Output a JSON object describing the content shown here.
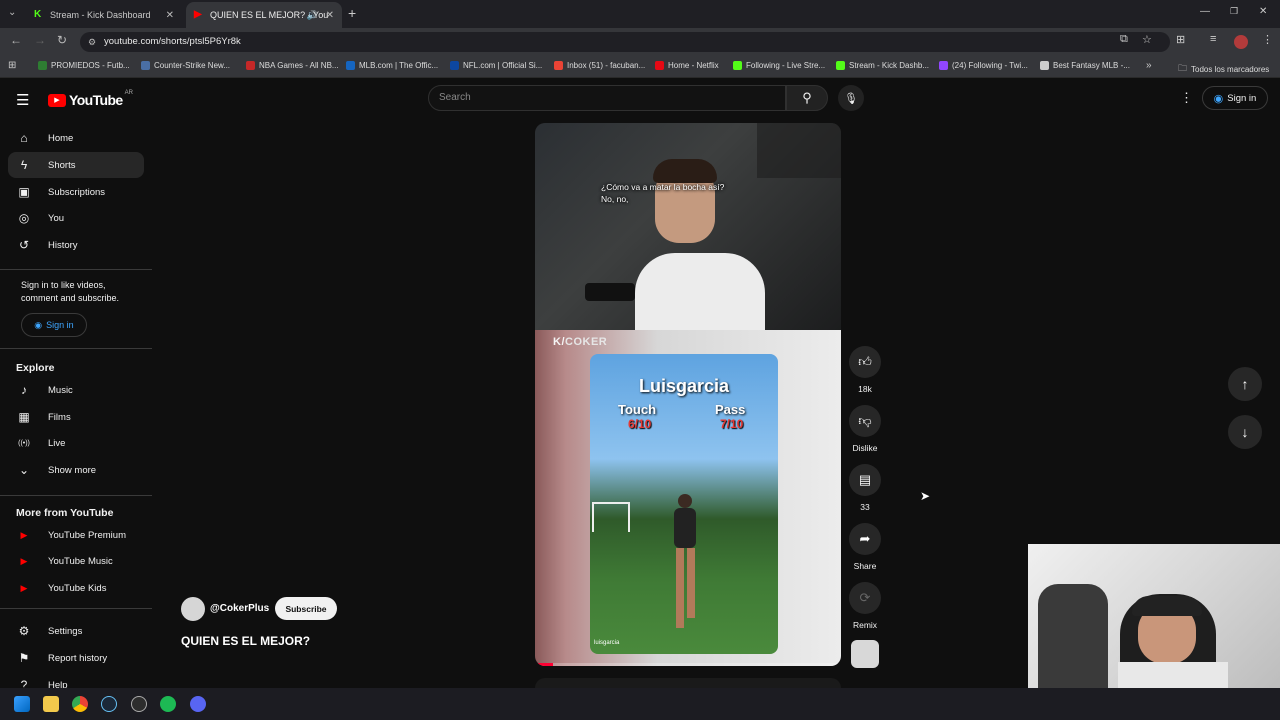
{
  "browser": {
    "tabs": [
      {
        "title": "Stream - Kick Dashboard",
        "active": false
      },
      {
        "title": "QUIEN ES EL MEJOR? - You",
        "active": true
      }
    ],
    "url": "youtube.com/shorts/ptsl5P6Yr8k",
    "bookmarks": [
      {
        "label": "PROMIEDOS - Futb...",
        "color": "#2e7d32"
      },
      {
        "label": "Counter-Strike New...",
        "color": "#4a6fa5"
      },
      {
        "label": "NBA Games - All NB...",
        "color": "#c62828"
      },
      {
        "label": "MLB.com | The Offic...",
        "color": "#1565c0"
      },
      {
        "label": "NFL.com | Official Si...",
        "color": "#0d47a1"
      },
      {
        "label": "Inbox (51) - facuban...",
        "color": "#ea4335"
      },
      {
        "label": "Home - Netflix",
        "color": "#e50914"
      },
      {
        "label": "Following - Live Stre...",
        "color": "#53fc18"
      },
      {
        "label": "Stream - Kick Dashb...",
        "color": "#53fc18"
      },
      {
        "label": "(24) Following - Twi...",
        "color": "#9146ff"
      },
      {
        "label": "Best Fantasy MLB -...",
        "color": "#cccccc"
      }
    ],
    "bookmarks_all": "Todos los marcadores"
  },
  "youtube": {
    "logo_text": "YouTube",
    "country": "AR",
    "search_placeholder": "Search",
    "sign_in": "Sign in",
    "sidebar": {
      "main": [
        {
          "label": "Home",
          "icon": "home-icon"
        },
        {
          "label": "Shorts",
          "icon": "shorts-icon"
        },
        {
          "label": "Subscriptions",
          "icon": "subscriptions-icon"
        },
        {
          "label": "You",
          "icon": "you-icon"
        },
        {
          "label": "History",
          "icon": "history-icon"
        }
      ],
      "signin_prompt": "Sign in to like videos, comment and subscribe.",
      "signin_button": "Sign in",
      "explore_title": "Explore",
      "explore": [
        {
          "label": "Music",
          "icon": "music-icon"
        },
        {
          "label": "Films",
          "icon": "films-icon"
        },
        {
          "label": "Live",
          "icon": "live-icon"
        },
        {
          "label": "Show more",
          "icon": "chevron-down-icon"
        }
      ],
      "more_title": "More from YouTube",
      "more": [
        {
          "label": "YouTube Premium"
        },
        {
          "label": "YouTube Music"
        },
        {
          "label": "YouTube Kids"
        }
      ],
      "bottom": [
        {
          "label": "Settings",
          "icon": "gear-icon"
        },
        {
          "label": "Report history",
          "icon": "flag-icon"
        },
        {
          "label": "Help",
          "icon": "help-icon"
        }
      ]
    },
    "short": {
      "subtitle_line1": "¿Cómo va a matar la bocha así?",
      "subtitle_line2": "No, no,",
      "watermark": "COKER",
      "inner_title": "Luisgarcia",
      "touch_label": "Touch",
      "touch_score": "6/10",
      "pass_label": "Pass",
      "pass_score": "7/10",
      "inner_credit": "luisgarcia",
      "channel": "@CokerPlus",
      "subscribe": "Subscribe",
      "title": "QUIEN ES EL MEJOR?",
      "progress": 0.06
    },
    "actions": {
      "likes": "18k",
      "dislike": "Dislike",
      "comments": "33",
      "share": "Share",
      "remix": "Remix"
    }
  }
}
